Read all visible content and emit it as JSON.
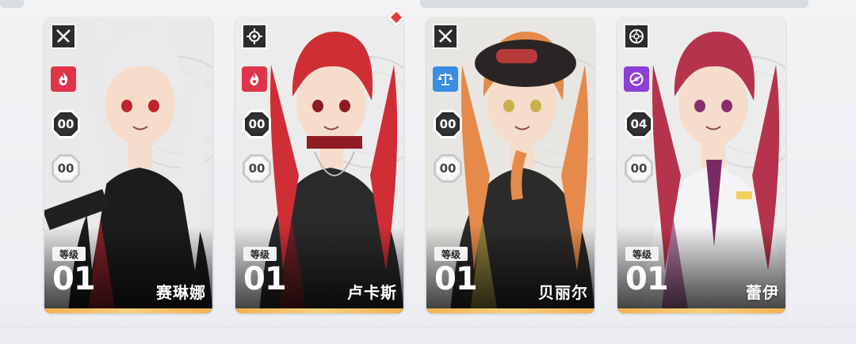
{
  "level_label": "等级",
  "cards": [
    {
      "name": "赛琳娜",
      "class_icon": "crossed-blades-icon",
      "element_icon": "fire-icon",
      "element_color": "#e0344a",
      "badge1": "00",
      "badge2": "00",
      "level": "01",
      "hair_color": "#eaeaea",
      "outfit_color": "#1c1c1e",
      "accent_color": "#c0252f",
      "bg_tint": "#e9e9ea"
    },
    {
      "name": "卢卡斯",
      "class_icon": "target-reticle-icon",
      "element_icon": "fire-icon",
      "element_color": "#e0344a",
      "badge1": "00",
      "badge2": "00",
      "level": "01",
      "hair_color": "#cf2e35",
      "outfit_color": "#2a2a2c",
      "accent_color": "#8f1c24",
      "bg_tint": "#ececec",
      "new_indicator": true
    },
    {
      "name": "贝丽尔",
      "class_icon": "crossed-blades-icon",
      "element_icon": "balance-scale-icon",
      "element_color": "#3a8de0",
      "badge1": "00",
      "badge2": "00",
      "level": "01",
      "hair_color": "#e58a4a",
      "outfit_color": "#2d2a2a",
      "accent_color": "#c9b04a",
      "bg_tint": "#e8e6e3"
    },
    {
      "name": "蕾伊",
      "class_icon": "crosshair-circle-icon",
      "element_icon": "void-orb-icon",
      "element_color": "#8b3fd6",
      "badge1": "04",
      "badge2": "00",
      "level": "01",
      "hair_color": "#b6334d",
      "outfit_color": "#f4f4f6",
      "accent_color": "#8a2f6e",
      "bg_tint": "#ececed"
    }
  ]
}
